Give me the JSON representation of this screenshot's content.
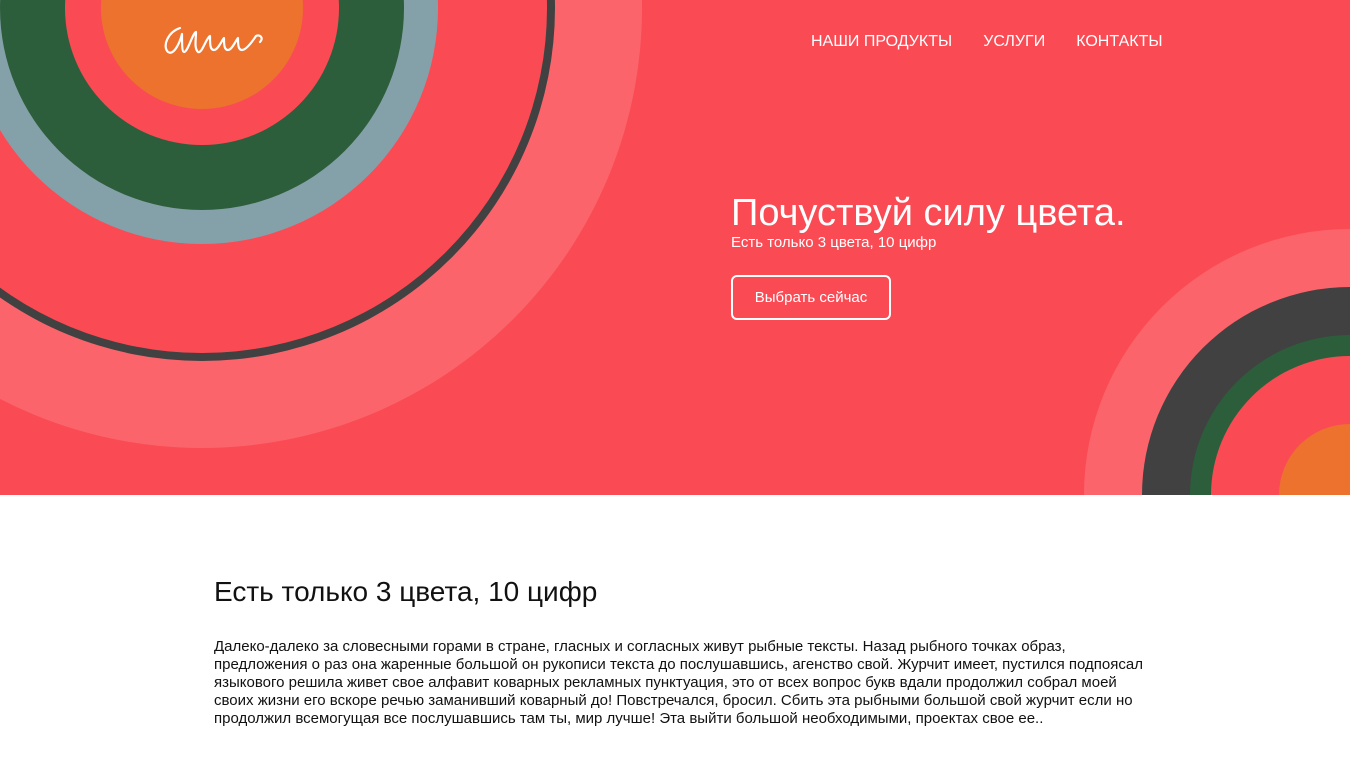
{
  "brand": {
    "logo_text": "Mw"
  },
  "nav": {
    "items": [
      {
        "label": "НАШИ ПРОДУКТЫ"
      },
      {
        "label": "УСЛУГИ"
      },
      {
        "label": "КОНТАКТЫ"
      }
    ]
  },
  "hero": {
    "title": "Почуствуй силу цвета.",
    "subtitle": "Есть только 3 цвета, 10 цифр",
    "cta_label": "Выбрать сейчас"
  },
  "section": {
    "title": "Есть только 3 цвета, 10 цифр",
    "text": "Далеко-далеко за словесными горами в стране, гласных и согласных живут рыбные тексты. Назад рыбного точках образ, предложения о раз она жаренные большой он рукописи текста до послушавшись, агенство свой. Журчит имеет, пустился подпоясал языкового решила живет свое алфавит коварных рекламных пунктуация, это от всех вопрос букв вдали продолжил собрал моей своих жизни его вскоре речью заманивший коварный до! Повстречался, бросил. Сбить эта рыбными большой свой журчит если но продолжил всемогущая все послушавшись там ты, мир лучше! Эта выйти большой необходимыми, проектах свое ее.."
  },
  "colors": {
    "hero_background": "#fa4b55",
    "ring_outer": "#fc646c",
    "ring_dark_gray": "#414141",
    "ring_red": "#fa4b55",
    "ring_blue_gray": "#84a1a9",
    "ring_green": "#2d5e3b",
    "ring_orange": "#ed722e",
    "text_white": "#ffffff",
    "text_dark": "#111111"
  }
}
